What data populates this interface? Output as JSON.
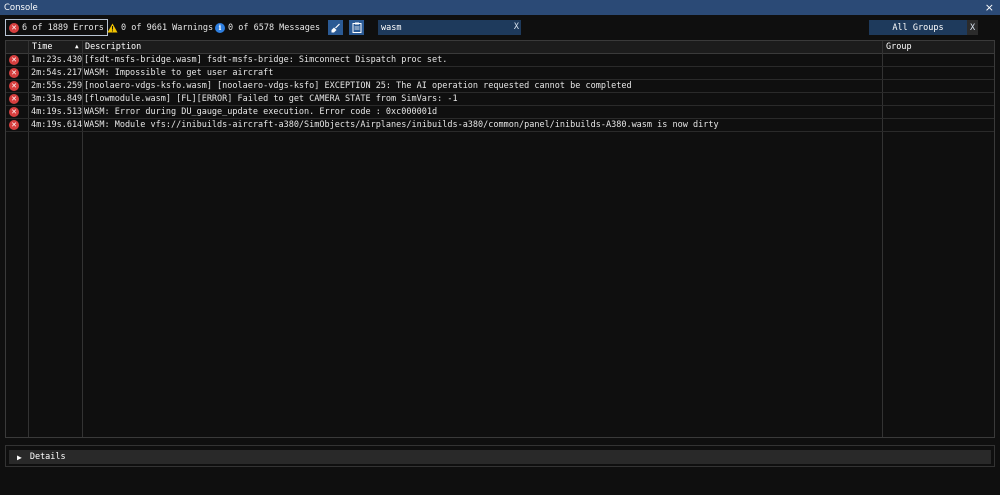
{
  "window": {
    "title": "Console",
    "close_glyph": "×"
  },
  "filters": {
    "errors": {
      "label": "6 of 1889 Errors",
      "icon": "error-icon"
    },
    "warnings": {
      "label": "0 of 9661 Warnings",
      "icon": "warning-icon"
    },
    "messages": {
      "label": "0 of 6578 Messages",
      "icon": "info-icon"
    }
  },
  "tools": {
    "clear_icon": "broom-icon",
    "copy_icon": "clipboard-icon"
  },
  "search": {
    "value": "wasm",
    "clear_label": "X"
  },
  "groups": {
    "label": "All Groups",
    "clear_label": "X"
  },
  "table": {
    "columns": {
      "time": "Time",
      "description": "Description",
      "group": "Group"
    },
    "sort": {
      "column": "time",
      "direction": "ascending"
    },
    "rows": [
      {
        "level": "error",
        "time": "1m:23s.430ms",
        "description": "[fsdt-msfs-bridge.wasm] fsdt-msfs-bridge: Simconnect Dispatch proc set.",
        "group": ""
      },
      {
        "level": "error",
        "time": "2m:54s.217ms",
        "description": "WASM: Impossible to get user aircraft",
        "group": ""
      },
      {
        "level": "error",
        "time": "2m:55s.259ms",
        "description": "[noolaero-vdgs-ksfo.wasm] [noolaero-vdgs-ksfo] EXCEPTION 25: The AI operation requested cannot be completed",
        "group": ""
      },
      {
        "level": "error",
        "time": "3m:31s.849ms",
        "description": "[flowmodule.wasm] [FL][ERROR] Failed to get CAMERA STATE from SimVars: -1",
        "group": ""
      },
      {
        "level": "error",
        "time": "4m:19s.513ms",
        "description": "WASM: Error during DU_gauge_update execution. Error code : 0xc000001d",
        "group": ""
      },
      {
        "level": "error",
        "time": "4m:19s.614ms",
        "description": "WASM: Module vfs://inibuilds-aircraft-a380/SimObjects/Airplanes/inibuilds-a380/common/panel/inibuilds-A380.wasm is now dirty",
        "group": ""
      }
    ]
  },
  "details": {
    "label": "Details",
    "expanded": false
  },
  "colors": {
    "titlebar": "#2b4a76",
    "background": "#0f0f0f",
    "error": "#d73f3f",
    "warning": "#f2c300",
    "info": "#2f7fe0",
    "button": "#2b5a94",
    "input": "#1e3a5c"
  }
}
